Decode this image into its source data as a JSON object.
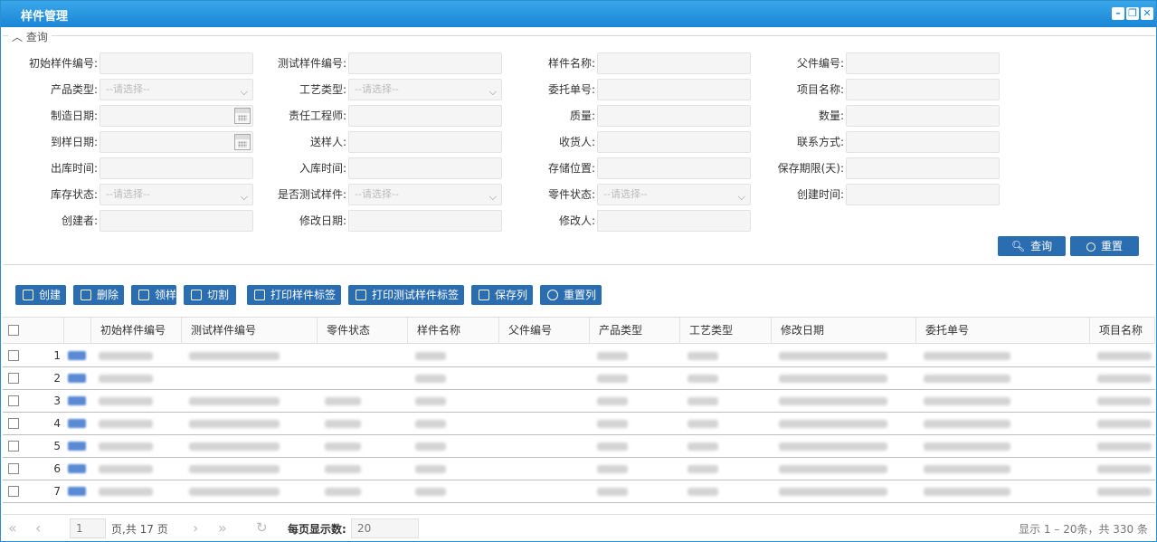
{
  "window": {
    "title": "样件管理"
  },
  "query": {
    "legend": "查询",
    "fields": [
      {
        "label": "初始样件编号:",
        "value": ""
      },
      {
        "label": "测试样件编号:",
        "value": ""
      },
      {
        "label": "样件名称:",
        "value": ""
      },
      {
        "label": "父件编号:",
        "value": ""
      },
      {
        "label": "产品类型:",
        "placeholder": "--请选择--",
        "type": "select"
      },
      {
        "label": "工艺类型:",
        "placeholder": "--请选择--",
        "type": "select"
      },
      {
        "label": "委托单号:",
        "value": ""
      },
      {
        "label": "项目名称:",
        "value": ""
      },
      {
        "label": "制造日期:",
        "value": "",
        "type": "date"
      },
      {
        "label": "责任工程师:",
        "value": ""
      },
      {
        "label": "质量:",
        "value": ""
      },
      {
        "label": "数量:",
        "value": ""
      },
      {
        "label": "到样日期:",
        "value": "",
        "type": "date"
      },
      {
        "label": "送样人:",
        "value": ""
      },
      {
        "label": "收货人:",
        "value": ""
      },
      {
        "label": "联系方式:",
        "value": ""
      },
      {
        "label": "出库时间:",
        "value": ""
      },
      {
        "label": "入库时间:",
        "value": ""
      },
      {
        "label": "存储位置:",
        "value": ""
      },
      {
        "label": "保存期限(天):",
        "value": ""
      },
      {
        "label": "库存状态:",
        "placeholder": "--请选择--",
        "type": "select"
      },
      {
        "label": "是否测试样件:",
        "placeholder": "--请选择--",
        "type": "select"
      },
      {
        "label": "零件状态:",
        "placeholder": "--请选择--",
        "type": "select"
      },
      {
        "label": "创建时间:",
        "value": ""
      },
      {
        "label": "创建者:",
        "value": ""
      },
      {
        "label": "修改日期:",
        "value": ""
      },
      {
        "label": "修改人:",
        "value": ""
      }
    ],
    "search_label": "查询",
    "reset_label": "重置"
  },
  "toolbar": [
    "创建",
    "删除",
    "领样",
    "切割",
    "打印样件标签",
    "打印测试样件标签",
    "保存列",
    "重置列"
  ],
  "table": {
    "columns": [
      "初始样件编号",
      "测试样件编号",
      "零件状态",
      "样件名称",
      "父件编号",
      "产品类型",
      "工艺类型",
      "修改日期",
      "委托单号",
      "项目名称"
    ],
    "rows": [
      {
        "n": "1",
        "cells": [
          "",
          "",
          "",
          "",
          "",
          "",
          "",
          "",
          "",
          ""
        ]
      },
      {
        "n": "2",
        "cells": [
          "",
          "",
          "",
          "",
          "",
          "",
          "",
          "",
          "",
          ""
        ]
      },
      {
        "n": "3",
        "cells": [
          "",
          "",
          "",
          "",
          "",
          "",
          "",
          "",
          "",
          ""
        ]
      },
      {
        "n": "4",
        "cells": [
          "",
          "",
          "",
          "",
          "",
          "",
          "",
          "",
          "",
          ""
        ]
      },
      {
        "n": "5",
        "cells": [
          "",
          "",
          "",
          "",
          "",
          "",
          "",
          "",
          "",
          ""
        ]
      },
      {
        "n": "6",
        "cells": [
          "",
          "",
          "",
          "",
          "",
          "",
          "",
          "",
          "",
          ""
        ]
      },
      {
        "n": "7",
        "cells": [
          "",
          "",
          "",
          "",
          "",
          "",
          "",
          "",
          "",
          ""
        ]
      }
    ]
  },
  "pager": {
    "page": "1",
    "of_text": "页,共 17 页",
    "per_page_label": "每页显示数:",
    "per_page": "20",
    "summary": "显示 1 – 20条，共 330 条"
  },
  "colors": {
    "title_bar": "#1a86d6",
    "button": "#2b6db1"
  }
}
